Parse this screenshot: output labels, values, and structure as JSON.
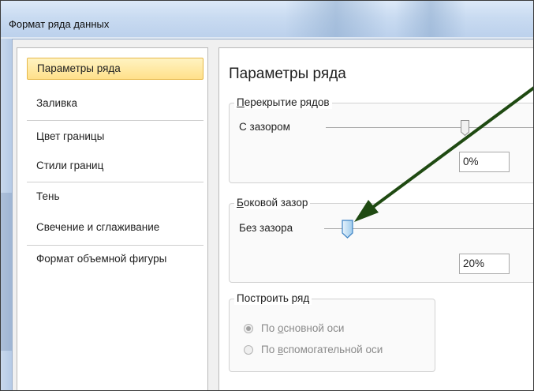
{
  "window": {
    "title": "Формат ряда данных"
  },
  "nav": {
    "items": [
      {
        "label": "Параметры ряда",
        "selected": true
      },
      {
        "label": "Заливка"
      },
      {
        "label": "Цвет границы"
      },
      {
        "label": "Стили границ"
      },
      {
        "label": "Тень"
      },
      {
        "label": "Свечение и сглаживание"
      },
      {
        "label": "Формат объемной фигуры"
      }
    ]
  },
  "panel": {
    "title": "Параметры ряда",
    "overlap": {
      "legend_underlined": "П",
      "legend_rest": "ерекрытие рядов",
      "left_label": "С зазором",
      "value": "0%",
      "level_percent": 0
    },
    "gap": {
      "legend_underlined": "Б",
      "legend_rest": "оковой зазор",
      "left_label": "Без зазора",
      "value": "20%",
      "level_percent": 20
    },
    "plot_on": {
      "legend": "Построить ряд",
      "option_primary_pre": "По ",
      "option_primary_u": "о",
      "option_primary_post": "сновной оси",
      "option_secondary_pre": "По ",
      "option_secondary_u": "в",
      "option_secondary_post": "спомогательной оси",
      "selected": "primary"
    }
  },
  "colors": {
    "annotation_arrow": "#1f4a12",
    "nav_selected_bg": "#ffe08a",
    "thumb_active": "#5aa0d8"
  }
}
